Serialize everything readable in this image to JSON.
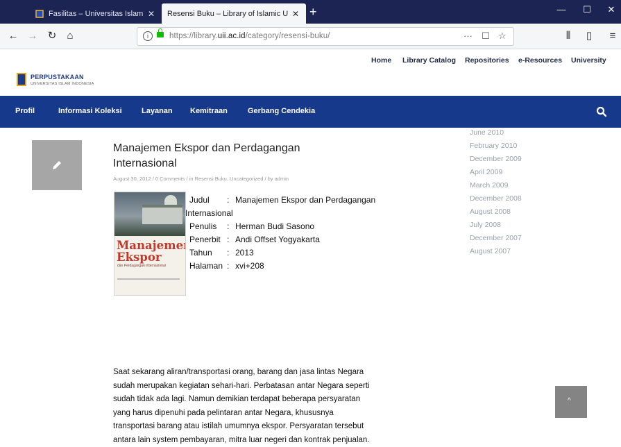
{
  "browser": {
    "tabs": [
      {
        "title": "Fasilitas – Universitas Islam Indo",
        "active": false
      },
      {
        "title": "Resensi Buku – Library of Islamic U",
        "active": true
      }
    ],
    "new_tab_icon": "plus-icon",
    "url": {
      "prefix": "https://library.",
      "domain": "uii.ac.id",
      "path": "/category/resensi-buku/"
    },
    "url_right_icons": [
      "more-icon",
      "pocket-icon",
      "star-icon"
    ]
  },
  "site": {
    "topnav": [
      "Home",
      "Library Catalog",
      "Repositories",
      "e-Resources",
      "University"
    ],
    "logo_title": "PERPUSTAKAAN",
    "logo_subtitle": "UNIVERSITAS ISLAM INDONESIA",
    "mainnav": [
      "Profil",
      "Informasi Koleksi",
      "Layanan",
      "Kemitraan",
      "Gerbang Cendekia"
    ]
  },
  "post": {
    "title_line1": "Manajemen Ekspor dan Perdagangan",
    "title_line2": "Internasional",
    "meta": "August 30, 2012 / 0 Comments / in Resensi Buku, Uncategorized / by admin",
    "cover": {
      "title_line1": "Manajemen",
      "title_line2": "Ekspor",
      "subtitle": "dan Perdagangan Internasional"
    },
    "details": {
      "judul_label": "Judul",
      "judul_value": "Manajemen Ekspor dan Perdagangan",
      "judul_wrap": "Internasional",
      "penulis_label": "Penulis",
      "penulis_value": "Herman Budi Sasono",
      "penerbit_label": "Penerbit",
      "penerbit_value": "Andi Offset Yogyakarta",
      "tahun_label": "Tahun",
      "tahun_value": "2013",
      "halaman_label": "Halaman",
      "halaman_value": "xvi+208",
      "separator": ":"
    },
    "excerpt": [
      "Saat sekarang aliran/transportasi orang, barang dan jasa lintas Negara",
      "sudah merupakan kegiatan sehari-hari. Perbatasan antar Negara seperti",
      "sudah tidak ada lagi. Namun demikian terdapat beberapa persyaratan",
      "yang harus dipenuhi pada pelintaran antar Negara, khususnya",
      "transportasi barang atau istilah umumnya ekspor. Persyaratan tersebut",
      "antara lain system pembayaran, mitra luar negeri dan kontrak penjualan."
    ]
  },
  "archive": [
    "June 2010",
    "February 2010",
    "December 2009",
    "April 2009",
    "March 2009",
    "December 2008",
    "August 2008",
    "July 2008",
    "December 2007",
    "August 2007"
  ],
  "colors": {
    "nav_blue": "#17398c",
    "tab_bar": "#1c2454"
  }
}
